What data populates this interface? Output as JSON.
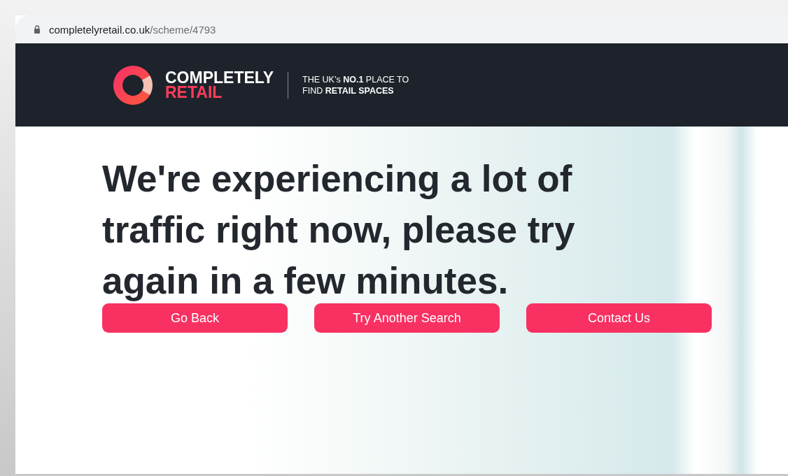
{
  "address_bar": {
    "domain": "completelyretail.co.uk",
    "path": "/scheme/4793"
  },
  "header": {
    "logo_line_1": "COMPLETELY",
    "logo_line_2": "RETAIL",
    "tagline_line_1": "THE UK’s **NO.1** PLACE TO",
    "tagline_line_2": "FIND **RETAIL SPACES**"
  },
  "message": "We're experiencing a lot of traffic right now, please try again in a few minutes.",
  "buttons": [
    "Go Back",
    "Try Another Search",
    "Contact Us"
  ]
}
